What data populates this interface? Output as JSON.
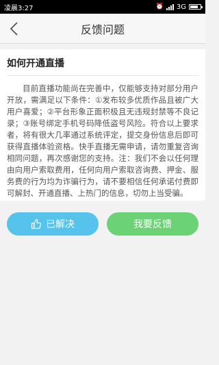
{
  "status_bar": {
    "time": "凌晨3:27",
    "network": "3G"
  },
  "nav": {
    "title": "反馈问题",
    "back_icon": "chevron-left-icon"
  },
  "article": {
    "title": "如何开通直播",
    "body": "目前直播功能尚在完善中，仅能够支持对部分用户开放，需满足以下条件：①发布较多优质作品且被广大用户喜爱；②平台形象正面积极且无违规封禁等不良记录；③账号绑定手机号码降低盗号风险。符合以上要求者，将有很大几率通过系统评定，提交身份信息后即可获得直播体验资格。快手直播无需申请，请勿重复咨询相同问题，再次感谢您的支持。注：我们不会以任何理由向用户索取费用，任何向用户索取咨询费、押金、服务费的行为均为诈骗行为，请不要相信任何承诺付费即可解封、开通直播、上热门的信息，切勿上当受骗。"
  },
  "actions": {
    "solved_label": "已解决",
    "solved_icon": "thumbs-up-icon",
    "feedback_label": "我要反馈"
  },
  "colors": {
    "solved": "#55c3ec",
    "feedback": "#6bd376"
  }
}
